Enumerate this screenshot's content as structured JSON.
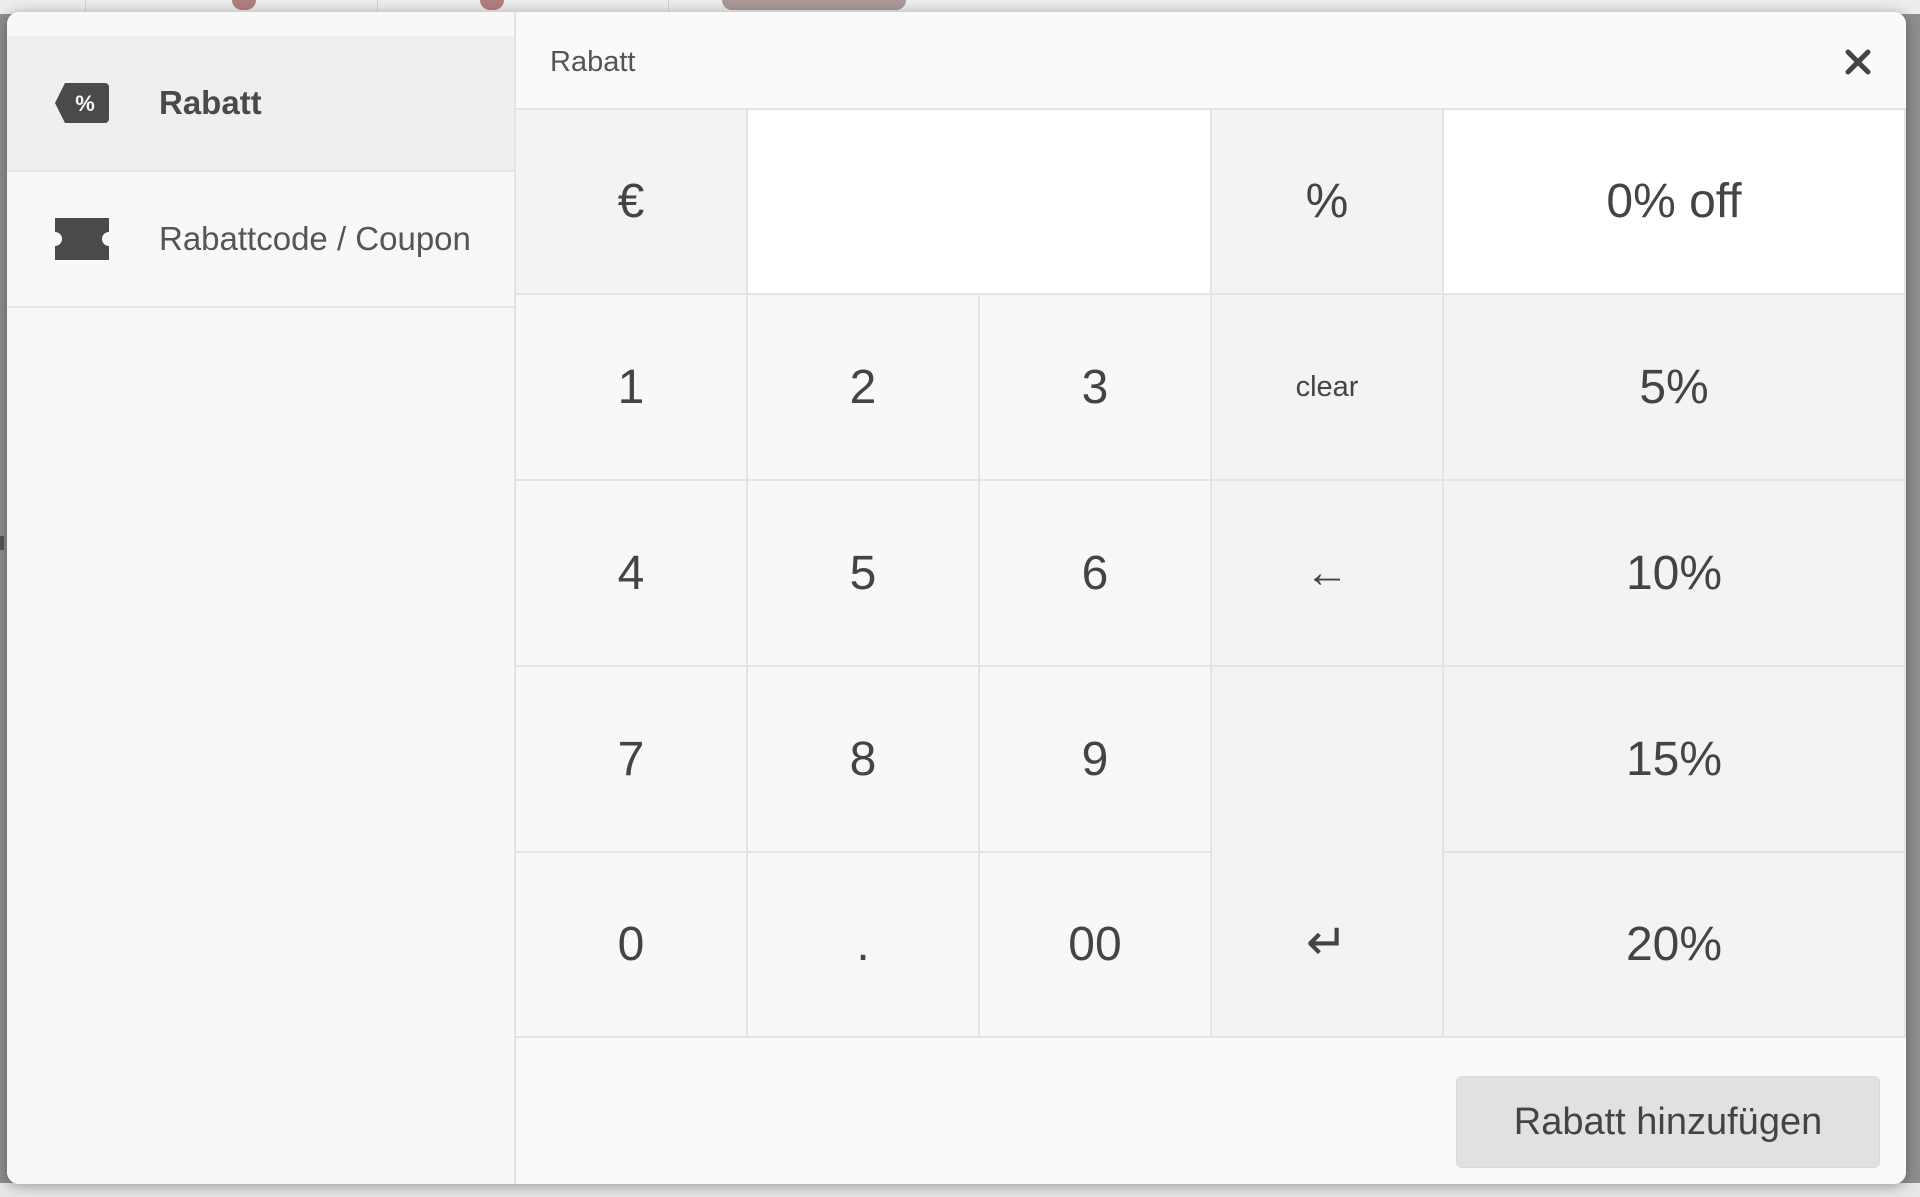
{
  "sidebar": {
    "items": [
      {
        "label": "Rabatt",
        "icon": "discount-tag-icon",
        "active": true
      },
      {
        "label": "Rabattcode / Coupon",
        "icon": "coupon-ticket-icon",
        "active": false
      }
    ]
  },
  "header": {
    "title": "Rabatt",
    "close_icon": "close-icon"
  },
  "display": {
    "currency_label": "€",
    "amount_value": "",
    "percent_label": "%",
    "result_text": "0% off"
  },
  "keypad": {
    "k1": "1",
    "k2": "2",
    "k3": "3",
    "k4": "4",
    "k5": "5",
    "k6": "6",
    "k7": "7",
    "k8": "8",
    "k9": "9",
    "k0": "0",
    "dot": ".",
    "k00": "00",
    "clear": "clear",
    "backspace": "←",
    "enter": "↵"
  },
  "presets": [
    "5%",
    "10%",
    "15%",
    "20%"
  ],
  "footer": {
    "add_label": "Rabatt hinzufügen"
  },
  "colors": {
    "text": "#444444",
    "panel": "#f8f8f8",
    "border": "#e4e4e4",
    "button": "#e1e1e1"
  }
}
